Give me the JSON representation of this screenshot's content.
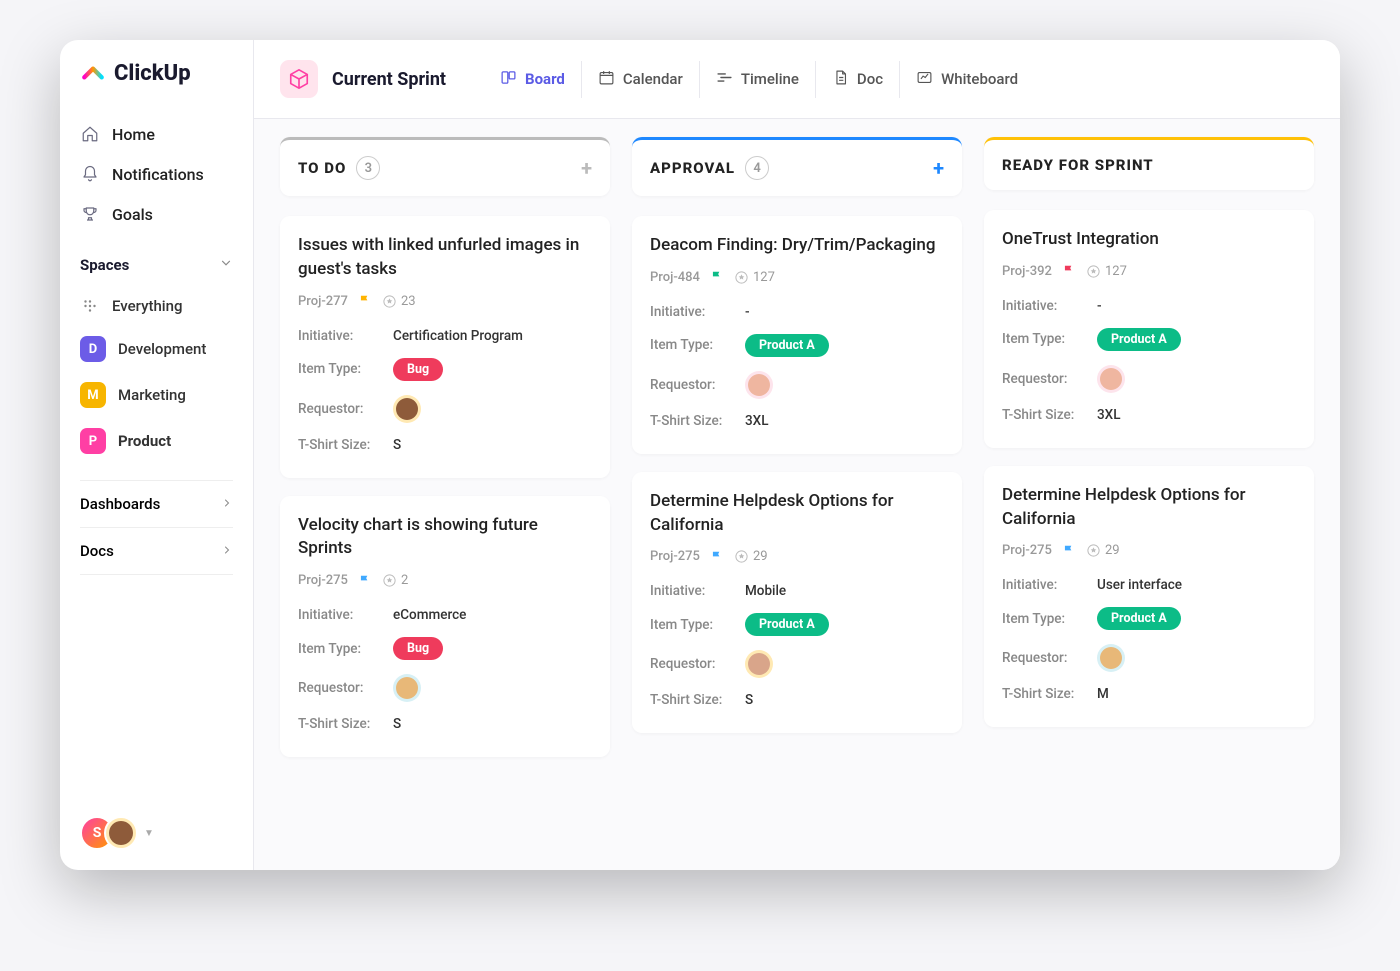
{
  "brand": "ClickUp",
  "nav": [
    {
      "label": "Home",
      "icon": "home"
    },
    {
      "label": "Notifications",
      "icon": "bell"
    },
    {
      "label": "Goals",
      "icon": "trophy"
    }
  ],
  "spacesHeader": "Spaces",
  "spacesItems": [
    {
      "label": "Everything",
      "icon": "grid"
    },
    {
      "label": "Development",
      "badge": "D",
      "color": "#6c5ce7"
    },
    {
      "label": "Marketing",
      "badge": "M",
      "color": "#f7b500"
    },
    {
      "label": "Product",
      "badge": "P",
      "color": "#ff3fa4",
      "active": true
    }
  ],
  "collapsibles": [
    {
      "label": "Dashboards"
    },
    {
      "label": "Docs"
    }
  ],
  "pageTitle": "Current Sprint",
  "viewTabs": [
    {
      "label": "Board",
      "icon": "board",
      "active": true
    },
    {
      "label": "Calendar",
      "icon": "calendar"
    },
    {
      "label": "Timeline",
      "icon": "timeline"
    },
    {
      "label": "Doc",
      "icon": "doc"
    },
    {
      "label": "Whiteboard",
      "icon": "whiteboard"
    }
  ],
  "columns": [
    {
      "title": "To Do",
      "count": "3",
      "accent": "#bbbbbb",
      "plusColor": "gray",
      "cards": [
        {
          "title": "Issues with linked unfurled images in guest's tasks",
          "proj": "Proj-277",
          "flag": "#ffb400",
          "stars": "23",
          "initiative": "Certification Program",
          "itemType": "Bug",
          "itemTypeClass": "bug",
          "requestorBg": "req-avatar",
          "requestorColor": "#8e5b3a",
          "tshirt": "S"
        },
        {
          "title": "Velocity chart is showing future Sprints",
          "proj": "Proj-275",
          "flag": "#40a9ff",
          "stars": "2",
          "initiative": "eCommerce",
          "itemType": "Bug",
          "itemTypeClass": "bug",
          "requestorBg": "req-avatar req-avatar-bg-blue",
          "requestorColor": "#e8b878",
          "tshirt": "S"
        }
      ]
    },
    {
      "title": "Approval",
      "count": "4",
      "accent": "#1e88ff",
      "plusColor": "blue",
      "cards": [
        {
          "title": "Deacom Finding: Dry/Trim/Packaging",
          "proj": "Proj-484",
          "flag": "#0cbc87",
          "stars": "127",
          "initiative": "-",
          "itemType": "Product A",
          "itemTypeClass": "productA",
          "requestorBg": "req-avatar req-avatar-bg-pink",
          "requestorColor": "#efb6a0",
          "tshirt": "3XL"
        },
        {
          "title": "Determine Helpdesk Options for California",
          "proj": "Proj-275",
          "flag": "#40a9ff",
          "stars": "29",
          "initiative": "Mobile",
          "itemType": "Product A",
          "itemTypeClass": "productA",
          "requestorBg": "req-avatar",
          "requestorColor": "#d9a58a",
          "tshirt": "S"
        }
      ]
    },
    {
      "title": "Ready for Sprint",
      "count": "",
      "accent": "#ffc107",
      "plusColor": "none",
      "cards": [
        {
          "title": "OneTrust Integration",
          "proj": "Proj-392",
          "flag": "#ef3b5c",
          "stars": "127",
          "initiative": "-",
          "itemType": "Product A",
          "itemTypeClass": "productA",
          "requestorBg": "req-avatar req-avatar-bg-pink",
          "requestorColor": "#efb6a0",
          "tshirt": "3XL"
        },
        {
          "title": "Determine Helpdesk Options for California",
          "proj": "Proj-275",
          "flag": "#40a9ff",
          "stars": "29",
          "initiative": "User interface",
          "itemType": "Product A",
          "itemTypeClass": "productA",
          "requestorBg": "req-avatar req-avatar-bg-blue",
          "requestorColor": "#e8b878",
          "tshirt": "M"
        }
      ]
    }
  ],
  "fieldLabels": {
    "initiative": "Initiative:",
    "itemType": "Item Type:",
    "requestor": "Requestor:",
    "tshirt": "T-Shirt Size:"
  },
  "userInitial": "S"
}
